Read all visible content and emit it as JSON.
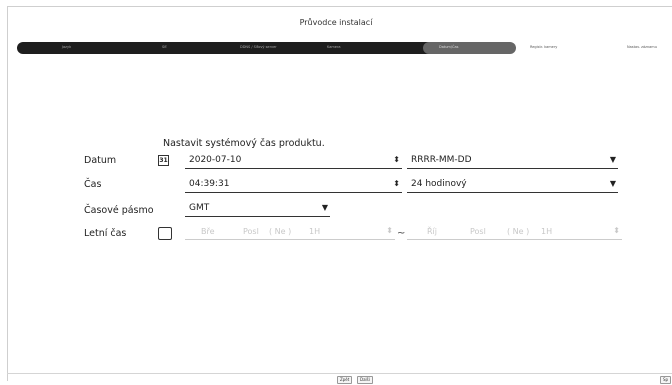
{
  "window": {
    "title": "Průvodce instalací"
  },
  "steps": [
    "Jazyk",
    "Síť",
    "DDNS / Síťový server",
    "Kamera",
    "Datum/Čas",
    "Registr. kamery",
    "Nastav. záznamu"
  ],
  "intro": "Nastavit systémový čas produktu.",
  "date": {
    "label": "Datum",
    "value": "2020-07-10",
    "format": "RRRR-MM-DD",
    "calendar_icon_text": "31"
  },
  "time": {
    "label": "Čas",
    "value": "04:39:31",
    "format": "24 hodinový"
  },
  "timezone": {
    "label": "Časové pásmo",
    "value": "GMT"
  },
  "dst": {
    "label": "Letní čas",
    "checked": false,
    "start": {
      "month": "Bře",
      "week": "Posl",
      "day": "( Ne )",
      "hour": "1H"
    },
    "end": {
      "month": "Říj",
      "week": "Posl",
      "day": "( Ne )",
      "hour": "1H"
    },
    "separator": "~"
  },
  "footer": {
    "back_label": "Zpět",
    "next_label": "Další",
    "right_label": "Sp"
  }
}
